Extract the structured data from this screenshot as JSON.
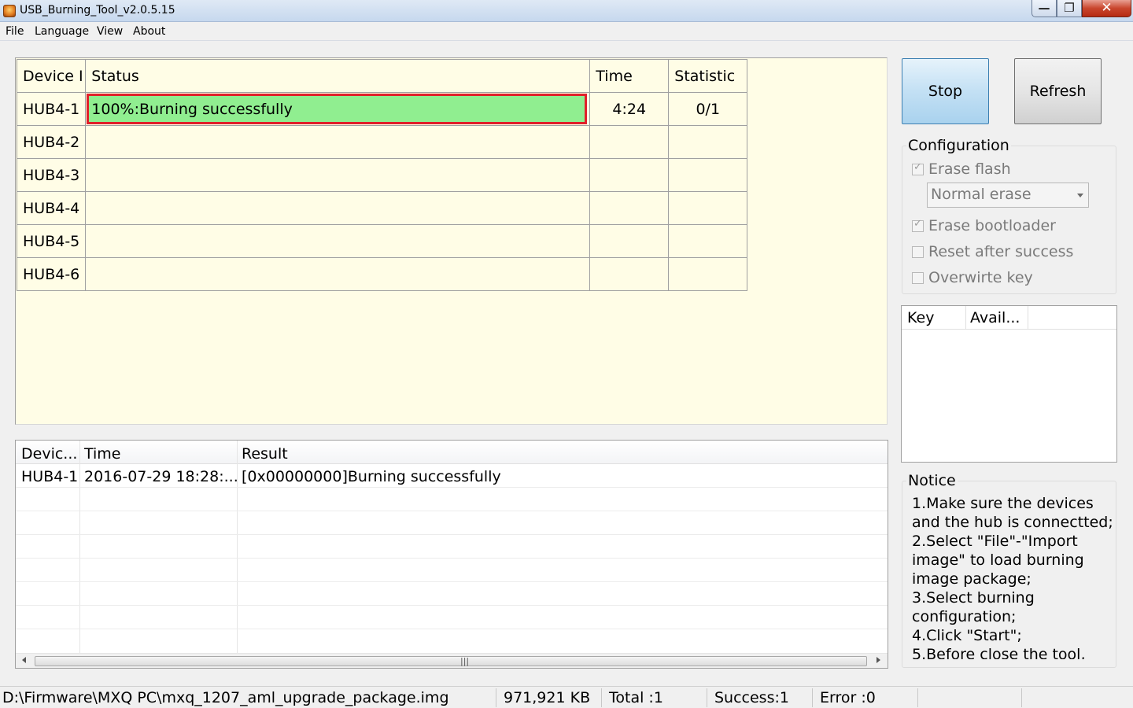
{
  "window": {
    "title": "USB_Burning_Tool_v2.0.5.15",
    "controls": {
      "minimize": "—",
      "maximize": "❐",
      "close": "✕"
    }
  },
  "menu": [
    "File",
    "Language",
    "View",
    "About"
  ],
  "device_table": {
    "headers": [
      "Device I",
      "Status",
      "Time",
      "Statistic"
    ],
    "rows": [
      {
        "device": "HUB4-1",
        "status": "100%:Burning successfully",
        "time": "4:24",
        "statistic": "0/1"
      },
      {
        "device": "HUB4-2",
        "status": "",
        "time": "",
        "statistic": ""
      },
      {
        "device": "HUB4-3",
        "status": "",
        "time": "",
        "statistic": ""
      },
      {
        "device": "HUB4-4",
        "status": "",
        "time": "",
        "statistic": ""
      },
      {
        "device": "HUB4-5",
        "status": "",
        "time": "",
        "statistic": ""
      },
      {
        "device": "HUB4-6",
        "status": "",
        "time": "",
        "statistic": ""
      }
    ],
    "progress_fraction": 1.0
  },
  "buttons": {
    "stop": "Stop",
    "refresh": "Refresh"
  },
  "configuration": {
    "title": "Configuration",
    "erase_flash": {
      "label": "Erase flash",
      "checked": true,
      "enabled": false
    },
    "erase_mode": "Normal erase",
    "erase_bootloader": {
      "label": "Erase bootloader",
      "checked": true,
      "enabled": false
    },
    "reset_after_success": {
      "label": "Reset after success",
      "checked": false,
      "enabled": false
    },
    "overwrite_key": {
      "label": "Overwirte key",
      "checked": false,
      "enabled": false
    }
  },
  "key_list": {
    "headers": [
      "Key",
      "Avail..."
    ]
  },
  "notice": {
    "title": "Notice",
    "lines": [
      "1.Make sure the devices",
      "and the hub is connectted;",
      "2.Select \"File\"-\"Import",
      "image\" to load burning",
      "image package;",
      "3.Select burning",
      "configuration;",
      "4.Click \"Start\";",
      "5.Before close the tool,"
    ]
  },
  "log": {
    "headers": [
      "Devic...",
      "Time",
      "Result"
    ],
    "rows": [
      {
        "device": "HUB4-1",
        "time": "2016-07-29 18:28:...",
        "result": "[0x00000000]Burning successfully"
      }
    ]
  },
  "statusbar": {
    "path": "D:\\Firmware\\MXQ PC\\mxq_1207_aml_upgrade_package.img",
    "size": "971,921 KB",
    "total": "Total :1",
    "success": "Success:1",
    "error": "Error :0"
  },
  "colors": {
    "grid_background": "#fffde6",
    "success_fill": "#90ee90",
    "highlight_border": "#e0202a"
  }
}
